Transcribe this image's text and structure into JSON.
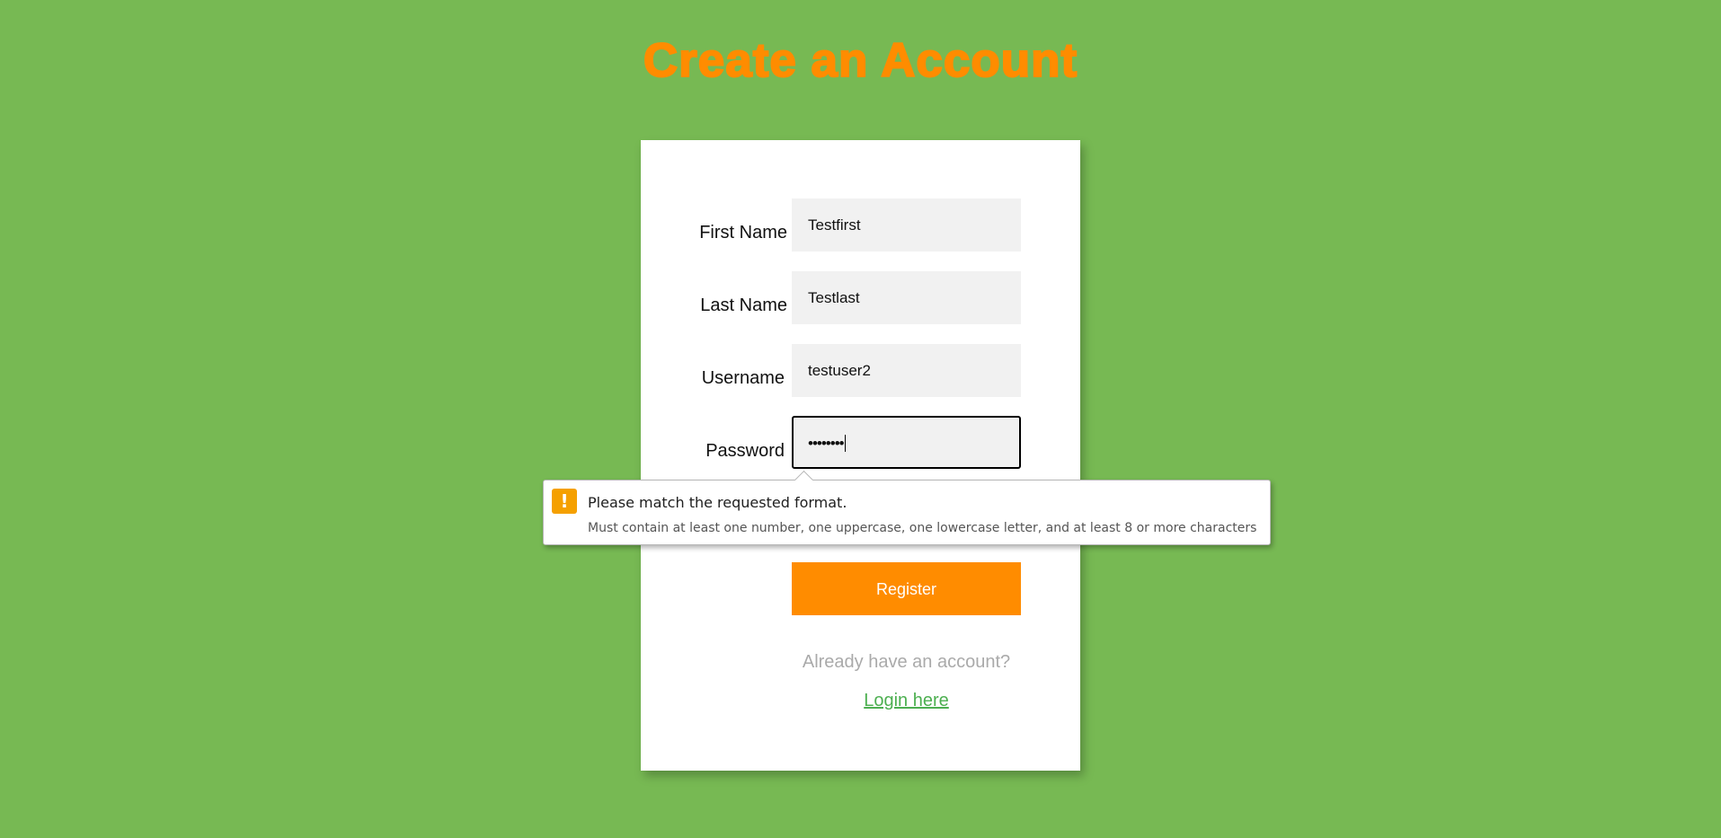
{
  "page": {
    "title": "Create an Account"
  },
  "form": {
    "first_name": {
      "label": "First Name",
      "value": "Testfirst"
    },
    "last_name": {
      "label": "Last Name",
      "value": "Testlast"
    },
    "username": {
      "label": "Username",
      "value": "testuser2"
    },
    "password": {
      "label": "Password",
      "value_masked": "••••••••"
    },
    "register_label": "Register",
    "already_text": "Already have an account?",
    "login_link": "Login here"
  },
  "validation_tooltip": {
    "icon": "warning-icon",
    "icon_glyph": "!",
    "title": "Please match the requested format.",
    "detail": "Must contain at least one number, one uppercase, one lowercase letter, and at least 8 or more characters"
  },
  "colors": {
    "background": "#77b953",
    "accent": "#ff8c00",
    "link": "#4caf50",
    "warning": "#f5a000"
  }
}
